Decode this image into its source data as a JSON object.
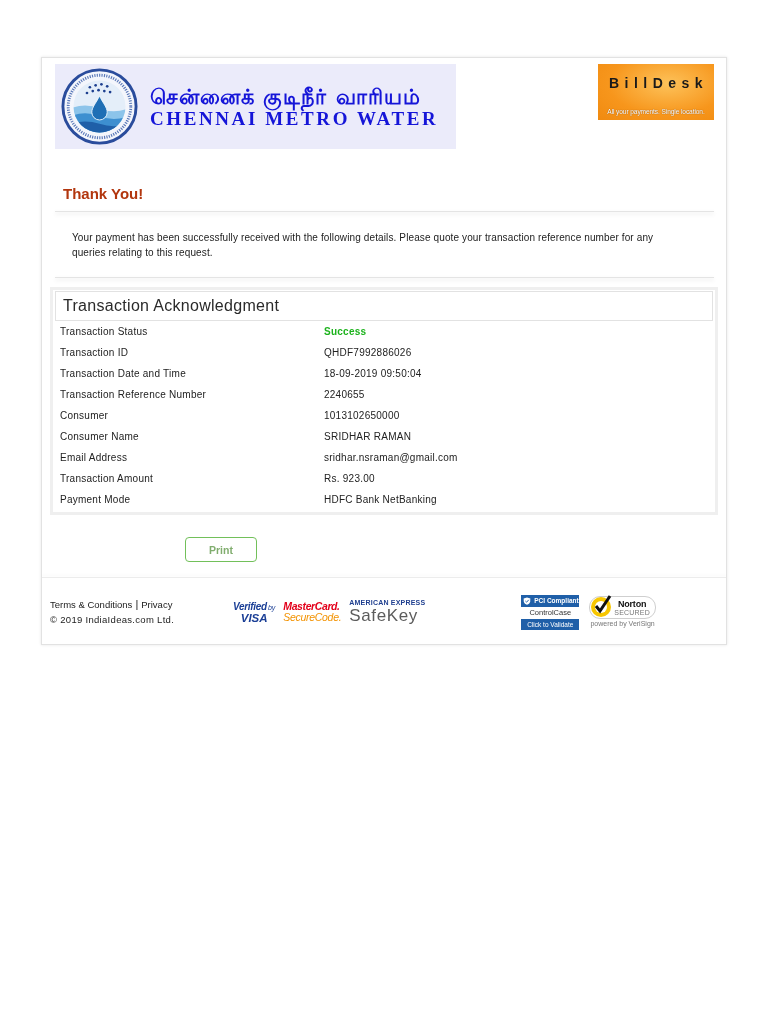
{
  "header": {
    "org_logo": {
      "tamil_name": "சென்னைக் குடிநீர் வாரியம்",
      "english_name": "CHENNAI METRO WATER"
    },
    "billdesk_logo": {
      "wordmark": "BillDesk",
      "tagline": "All your payments. Single location."
    }
  },
  "thank_you": {
    "title": "Thank You!",
    "message": "Your payment has been successfully received with the following details. Please quote your transaction reference number for any queries relating to this request."
  },
  "acknowledgment": {
    "title": "Transaction Acknowledgment",
    "rows": [
      {
        "kind": "status",
        "label": "Transaction Status",
        "value": "Success"
      },
      {
        "kind": "text",
        "label": "Transaction ID",
        "value": "QHDF7992886026"
      },
      {
        "kind": "text",
        "label": "Transaction Date and Time",
        "value": "18-09-2019 09:50:04"
      },
      {
        "kind": "text",
        "label": "Transaction Reference Number",
        "value": "2240655"
      },
      {
        "kind": "text",
        "label": "Consumer",
        "value": "1013102650000"
      },
      {
        "kind": "text",
        "label": "Consumer Name",
        "value": "SRIDHAR RAMAN"
      },
      {
        "kind": "text",
        "label": "Email Address",
        "value": "sridhar.nsraman@gmail.com"
      },
      {
        "kind": "text",
        "label": "Transaction Amount",
        "value": "Rs. 923.00"
      },
      {
        "kind": "text",
        "label": "Payment Mode",
        "value": "HDFC Bank NetBanking"
      }
    ]
  },
  "actions": {
    "print_button": "Print"
  },
  "footer": {
    "links": [
      {
        "label": "Terms & Conditions"
      },
      {
        "label": "Privacy"
      }
    ],
    "separator": "|",
    "copyright": "© 2019 IndiaIdeas.com Ltd.",
    "security_badges": [
      {
        "kind": "visa",
        "lines": [
          "Verified",
          "by",
          "VISA"
        ]
      },
      {
        "kind": "mastercard",
        "lines": [
          "MasterCard.",
          "SecureCode."
        ]
      },
      {
        "kind": "amex",
        "lines": [
          "AMERICAN EXPRESS",
          "SafeKey"
        ]
      },
      {
        "kind": "pci",
        "lines": [
          "PCI Compliant",
          "ControlCase",
          "Click to Validate"
        ]
      },
      {
        "kind": "norton",
        "lines": [
          "Norton",
          "SECURED",
          "powered by VeriSign"
        ]
      }
    ]
  }
}
